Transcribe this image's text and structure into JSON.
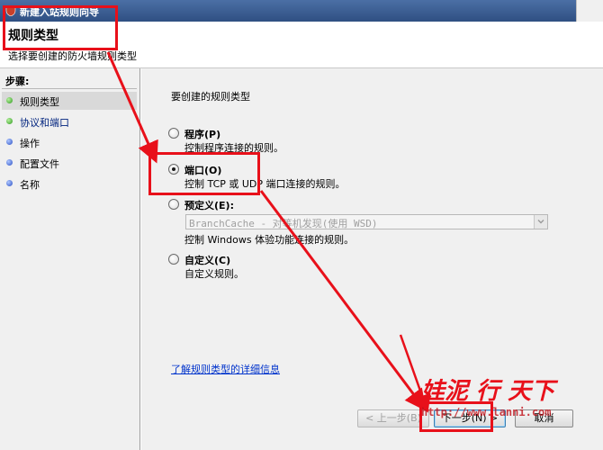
{
  "window": {
    "title": "新建入站规则向导",
    "icon": "firewall-shield-icon"
  },
  "header": {
    "title": "规则类型",
    "subtitle": "选择要创建的防火墙规则类型"
  },
  "sidebar": {
    "heading": "步骤:",
    "items": [
      {
        "label": "规则类型",
        "state": "current",
        "dot_color": "#2e9a1e"
      },
      {
        "label": "协议和端口",
        "state": "next",
        "dot_color": "#2e9a1e"
      },
      {
        "label": "操作",
        "state": "pending",
        "dot_color": "#2a4fc4"
      },
      {
        "label": "配置文件",
        "state": "pending",
        "dot_color": "#2a4fc4"
      },
      {
        "label": "名称",
        "state": "pending",
        "dot_color": "#2a4fc4"
      }
    ]
  },
  "main": {
    "question": "要创建的规则类型",
    "options": [
      {
        "label": "程序(P)",
        "description": "控制程序连接的规则。",
        "checked": false
      },
      {
        "label": "端口(O)",
        "description": "控制 TCP 或 UDP 端口连接的规则。",
        "checked": true
      },
      {
        "label": "预定义(E):",
        "description": "控制 Windows 体验功能连接的规则。",
        "checked": false
      },
      {
        "label": "自定义(C)",
        "description": "自定义规则。",
        "checked": false
      }
    ],
    "predefined_select": {
      "value": "BranchCache - 对等机发现(使用 WSD)",
      "enabled": false
    },
    "learn_more": "了解规则类型的详细信息"
  },
  "buttons": {
    "back": "< 上一步(B)",
    "next": "下一步(N) >",
    "cancel": "取消"
  },
  "watermark": {
    "text": "娃泥 行 天下",
    "url": "http://www.lanni.com"
  },
  "colors": {
    "annotation_red": "#e8101a",
    "titlebar_blue": "#3a5e96",
    "link_blue": "#0033cc"
  }
}
